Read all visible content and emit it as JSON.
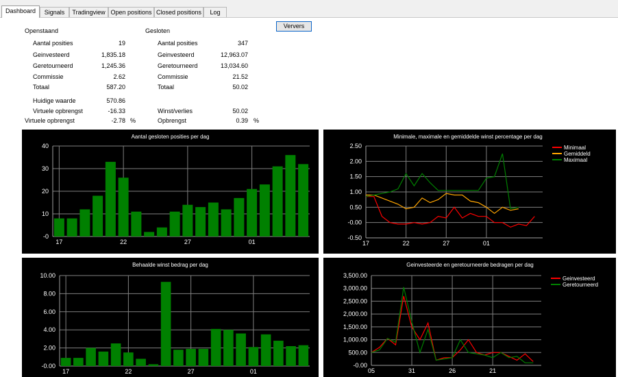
{
  "tabs": [
    "Dashboard",
    "Signals",
    "Tradingview",
    "Open positions",
    "Closed positions",
    "Log"
  ],
  "refresh_label": "Ververs",
  "open": {
    "title": "Openstaand",
    "rows": [
      {
        "label": "Aantal posities",
        "value": "19"
      },
      {
        "label": "Geinvesteerd",
        "value": "1,835.18"
      },
      {
        "label": "Geretourneerd",
        "value": "1,245.36"
      },
      {
        "label": "Commissie",
        "value": "2.62"
      },
      {
        "label": "Totaal",
        "value": "587.20"
      }
    ],
    "current_value_label": "Huidige waarde",
    "current_value": "570.86",
    "virtual_label_1": "Virtuele opbrengst",
    "virtual_value_1": "-16.33",
    "virtual_label_2": "Virtuele opbrengst",
    "virtual_value_2": "-2.78",
    "percent": "%"
  },
  "closed": {
    "title": "Gesloten",
    "rows": [
      {
        "label": "Aantal posities",
        "value": "347"
      },
      {
        "label": "Geinvesteerd",
        "value": "12,963.07"
      },
      {
        "label": "Geretourneerd",
        "value": "13,034.60"
      },
      {
        "label": "Commissie",
        "value": "21.52"
      },
      {
        "label": "Totaal",
        "value": "50.02"
      }
    ],
    "winloss_label": "Winst/verlies",
    "winloss_value": "50.02",
    "yield_label": "Opbrengst",
    "yield_value": "0.39",
    "percent": "%"
  },
  "colors": {
    "bar": "#008000",
    "red": "#ff0000",
    "orange": "#ffa500",
    "green": "#008000",
    "grid": "#808080"
  },
  "chart_data": [
    {
      "type": "bar",
      "title": "Aantal gesloten posities per dag",
      "values": [
        8,
        8,
        12,
        18,
        33,
        26,
        11,
        2,
        4,
        11,
        14,
        13,
        15,
        12,
        17,
        21,
        23,
        31,
        36,
        32
      ],
      "xticks": [
        {
          "i": 0,
          "label": "17"
        },
        {
          "i": 5,
          "label": "22"
        },
        {
          "i": 10,
          "label": "27"
        },
        {
          "i": 15,
          "label": "01"
        }
      ],
      "yticks": [
        "40",
        "30",
        "20",
        "10",
        "-0"
      ],
      "ylim": [
        0,
        40
      ]
    },
    {
      "type": "line",
      "title": "Minimale, maximale en gemiddelde winst percentage per dag",
      "series": [
        {
          "name": "Minimaal",
          "color": "#ff0000",
          "values": [
            0.85,
            0.85,
            0.2,
            0.0,
            -0.05,
            -0.05,
            0.0,
            -0.05,
            0.0,
            0.2,
            0.15,
            0.5,
            0.15,
            0.3,
            0.2,
            0.2,
            0.0,
            0.0,
            -0.15,
            -0.05,
            -0.1,
            0.2
          ]
        },
        {
          "name": "Gemiddeld",
          "color": "#ffa500",
          "values": [
            0.9,
            0.9,
            0.8,
            0.7,
            0.6,
            0.45,
            0.5,
            0.8,
            0.65,
            0.75,
            0.95,
            0.9,
            0.9,
            0.7,
            0.65,
            0.5,
            0.3,
            0.5,
            0.4,
            0.45
          ]
        },
        {
          "name": "Maximaal",
          "color": "#008000",
          "values": [
            0.85,
            0.9,
            0.95,
            1.0,
            1.1,
            1.6,
            1.2,
            1.6,
            1.3,
            1.05,
            1.05,
            1.05,
            1.05,
            1.05,
            1.05,
            1.45,
            1.5,
            2.25,
            0.45,
            0.5
          ]
        }
      ],
      "xticks": [
        {
          "i": 0,
          "label": "17"
        },
        {
          "i": 5,
          "label": "22"
        },
        {
          "i": 10,
          "label": "27"
        },
        {
          "i": 15,
          "label": "01"
        }
      ],
      "yticks": [
        "2.50",
        "2.00",
        "1.50",
        "1.00",
        "0.50",
        "-0.00",
        "-0.50"
      ],
      "ylim": [
        -0.5,
        2.5
      ]
    },
    {
      "type": "bar",
      "title": "Behaalde winst bedrag per dag",
      "values": [
        0.9,
        0.9,
        2.0,
        1.6,
        2.5,
        1.5,
        0.8,
        0.2,
        9.3,
        1.8,
        1.9,
        1.9,
        4.1,
        4.0,
        3.6,
        2.1,
        3.5,
        2.8,
        2.2,
        2.3
      ],
      "xticks": [
        {
          "i": 0,
          "label": "17"
        },
        {
          "i": 5,
          "label": "22"
        },
        {
          "i": 10,
          "label": "27"
        },
        {
          "i": 15,
          "label": "01"
        }
      ],
      "yticks": [
        "10.00",
        "8.00",
        "6.00",
        "4.00",
        "2.00",
        "-0.00"
      ],
      "ylim": [
        0,
        10
      ]
    },
    {
      "type": "line",
      "title": "Geinvesteerde en geretourneerde bedragen per dag",
      "series": [
        {
          "name": "Geinvesteerd",
          "color": "#ff0000",
          "values": [
            500,
            700,
            1050,
            800,
            2700,
            1500,
            1000,
            1650,
            200,
            300,
            300,
            600,
            1000,
            500,
            400,
            500,
            500,
            350,
            200,
            450,
            150
          ]
        },
        {
          "name": "Geretourneerd",
          "color": "#008000",
          "values": [
            500,
            600,
            1050,
            900,
            3050,
            1700,
            500,
            1400,
            200,
            250,
            300,
            1000,
            500,
            450,
            400,
            300,
            500,
            300,
            350,
            100,
            100
          ]
        }
      ],
      "xticks": [
        {
          "i": 0,
          "label": "05"
        },
        {
          "i": 5,
          "label": "31"
        },
        {
          "i": 10,
          "label": "26"
        },
        {
          "i": 15,
          "label": "21"
        }
      ],
      "yticks": [
        "3,500.00",
        "3,000.00",
        "2,500.00",
        "2,000.00",
        "1,500.00",
        "1,000.00",
        "500.00",
        "-0.00"
      ],
      "ylim": [
        0,
        3500
      ]
    }
  ]
}
